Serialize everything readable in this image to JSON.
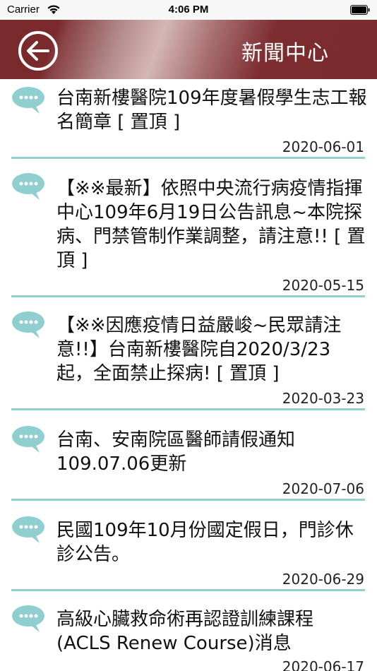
{
  "status_bar": {
    "carrier": "Carrier",
    "time": "4:06 PM"
  },
  "nav": {
    "title": "新聞中心",
    "back_icon": "back-arrow-circle-icon"
  },
  "colors": {
    "nav_background": "#7a2a2d",
    "divider": "#8fcfd0",
    "chat_icon": "#8fcfd0"
  },
  "news": [
    {
      "title": "台南新樓醫院109年度暑假學生志工報名簡章 [ 置頂 ]",
      "date": "2020-06-01"
    },
    {
      "title": "【※※最新】依照中央流行病疫情指揮中心109年6月19日公告訊息~本院探病、門禁管制作業調整，請注意!! [ 置頂 ]",
      "date": "2020-05-15"
    },
    {
      "title": "【※※因應疫情日益嚴峻~民眾請注意!!】台南新樓醫院自2020/3/23起，全面禁止探病! [ 置頂 ]",
      "date": "2020-03-23"
    },
    {
      "title": "台南、安南院區醫師請假通知109.07.06更新",
      "date": "2020-07-06"
    },
    {
      "title": "民國109年10月份國定假日，門診休診公告。",
      "date": "2020-06-29"
    },
    {
      "title": "高級心臟救命術再認證訓練課程(ACLS Renew Course)消息",
      "date": "2020-06-17"
    }
  ]
}
